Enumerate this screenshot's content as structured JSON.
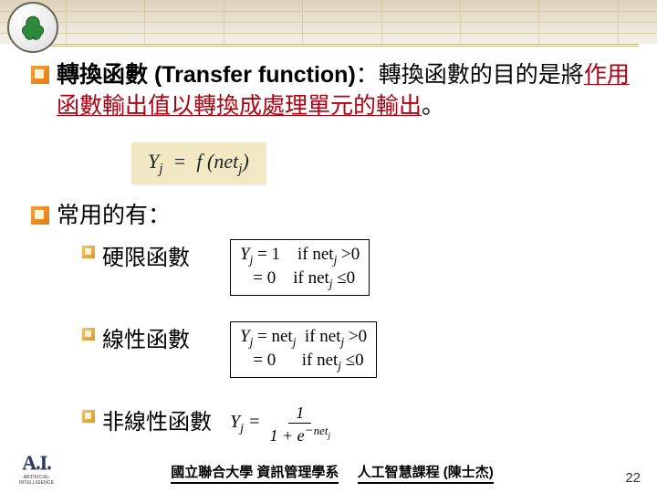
{
  "header": {
    "logo_alt": "university-seal"
  },
  "bullets": [
    {
      "title_bold": "轉換函數 (Transfer function)",
      "title_rest": "：轉換函數的目的是將",
      "highlight": "作用函數輸出值以轉換成處理單元的輸出",
      "tail": "。"
    },
    {
      "title_bold": "",
      "title_rest": "常用的有：",
      "highlight": "",
      "tail": ""
    }
  ],
  "main_formula": "Yⱼ = f (netⱼ)",
  "subitems": [
    {
      "label": "硬限函數",
      "lines": [
        {
          "lhs": "Yⱼ = 1",
          "cond": "if netⱼ >0"
        },
        {
          "lhs": "   = 0",
          "cond": "if netⱼ ≤0"
        }
      ]
    },
    {
      "label": "線性函數",
      "lines": [
        {
          "lhs": "Yⱼ = netⱼ",
          "cond": "if netⱼ >0"
        },
        {
          "lhs": "   = 0",
          "cond": "if netⱼ ≤0"
        }
      ]
    },
    {
      "label": "非線性函數",
      "frac": {
        "pre": "Yⱼ =",
        "num": "1",
        "den": "1 + e⁻ⁿᵉᵗʲ"
      }
    }
  ],
  "footer": {
    "ai_label": "A.I.",
    "ai_sub": "ARTIFICIAL INTELLIGENCE",
    "left_seg": "國立聯合大學 資訊管理學系",
    "right_seg": "人工智慧課程 (陳士杰)",
    "page": "22"
  }
}
